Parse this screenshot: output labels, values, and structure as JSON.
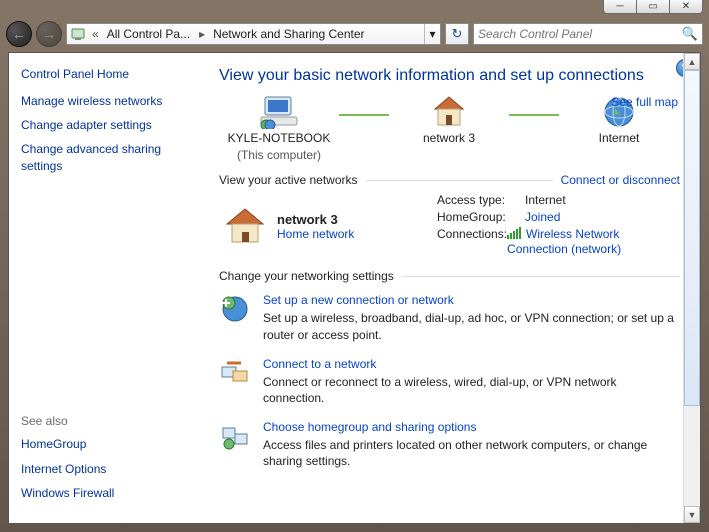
{
  "window": {
    "breadcrumb_root": "All Control Pa...",
    "breadcrumb_current": "Network and Sharing Center",
    "search_placeholder": "Search Control Panel"
  },
  "sidebar": {
    "home": "Control Panel Home",
    "links": [
      "Manage wireless networks",
      "Change adapter settings",
      "Change advanced sharing settings"
    ],
    "see_also_hd": "See also",
    "see_also": [
      "HomeGroup",
      "Internet Options",
      "Windows Firewall"
    ]
  },
  "main": {
    "title": "View your basic network information and set up connections",
    "see_full_map": "See full map",
    "map": {
      "computer": "KYLE-NOTEBOOK",
      "computer_sub": "(This computer)",
      "network": "network  3",
      "internet": "Internet"
    },
    "active_hd": "View your active networks",
    "connect_disconnect": "Connect or disconnect",
    "active": {
      "name": "network  3",
      "type": "Home network",
      "access_k": "Access type:",
      "access_v": "Internet",
      "homegroup_k": "HomeGroup:",
      "homegroup_v": "Joined",
      "conn_k": "Connections:",
      "conn_v": "Wireless Network Connection (network)"
    },
    "settings_hd": "Change your networking settings",
    "tasks": [
      {
        "title": "Set up a new connection or network",
        "desc": "Set up a wireless, broadband, dial-up, ad hoc, or VPN connection; or set up a router or access point."
      },
      {
        "title": "Connect to a network",
        "desc": "Connect or reconnect to a wireless, wired, dial-up, or VPN network connection."
      },
      {
        "title": "Choose homegroup and sharing options",
        "desc": "Access files and printers located on other network computers, or change sharing settings."
      }
    ]
  }
}
